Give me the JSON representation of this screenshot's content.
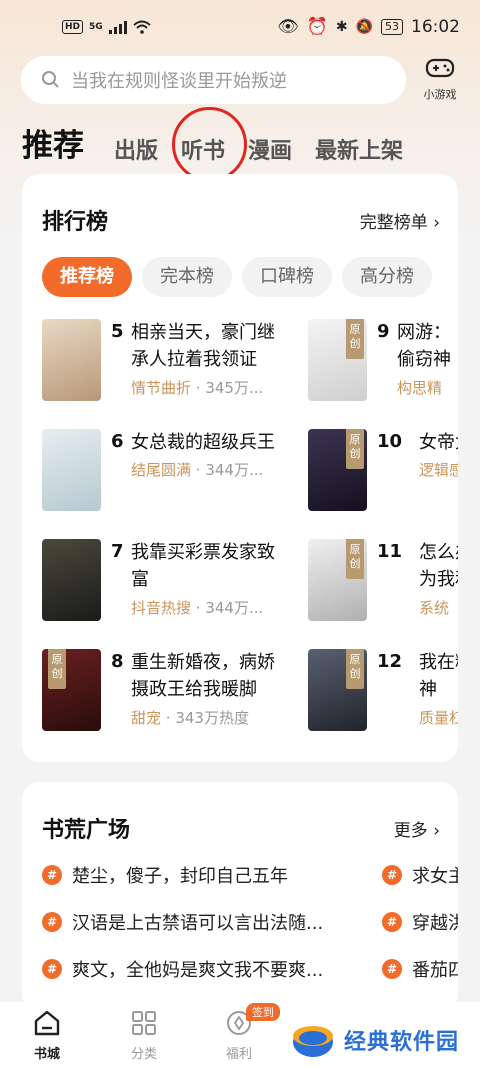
{
  "status_bar": {
    "time": "16:02",
    "battery": "53",
    "network": "5G"
  },
  "search": {
    "placeholder": "当我在规则怪谈里开始叛逆"
  },
  "game_button": {
    "label": "小游戏"
  },
  "tabs": [
    {
      "label": "推荐",
      "active": true
    },
    {
      "label": "出版"
    },
    {
      "label": "听书"
    },
    {
      "label": "漫画"
    },
    {
      "label": "最新上架"
    }
  ],
  "ranking": {
    "title": "排行榜",
    "more": "完整榜单 ›",
    "pills": [
      "推荐榜",
      "完本榜",
      "口碑榜",
      "高分榜"
    ],
    "items_left": [
      {
        "rank": "5",
        "title": "相亲当天，豪门继承人拉着我领证",
        "tag": "情节曲折",
        "heat": "· 345万...",
        "cover_color": "#d9c7b0",
        "badge": ""
      },
      {
        "rank": "6",
        "title": "女总裁的超级兵王",
        "tag": "结尾圆满",
        "heat": "· 344万...",
        "cover_color": "#cfe0e8",
        "badge": ""
      },
      {
        "rank": "7",
        "title": "我靠买彩票发家致富",
        "tag": "抖音热搜",
        "heat": "· 344万...",
        "cover_color": "#2a2a2a",
        "badge": ""
      },
      {
        "rank": "8",
        "title": "重生新婚夜，病娇摄政王给我暖脚",
        "tag": "甜宠",
        "heat": "· 343万热度",
        "cover_color": "#3a1a1a",
        "badge": "原创"
      }
    ],
    "items_right": [
      {
        "rank": "9",
        "title": "网游：偷窃神",
        "tag": "构思精",
        "cover_color": "#eaeaea",
        "badge": "原创"
      },
      {
        "rank": "10",
        "title": "女帝太",
        "tag": "逻辑感",
        "cover_color": "#2c2540",
        "badge": "原创"
      },
      {
        "rank": "11",
        "title": "怎么办为我和",
        "tag": "系统",
        "cover_color": "#e8e8e8",
        "badge": "原创"
      },
      {
        "rank": "12",
        "title": "我在精神",
        "tag": "质量杠",
        "cover_color": "#3a3e4a",
        "badge": "原创"
      }
    ]
  },
  "plaza": {
    "title": "书荒广场",
    "more": "更多 ›",
    "left": [
      "楚尘，傻子，封印自己五年",
      "汉语是上古禁语可以言出法随...",
      "爽文，全他妈是爽文我不要爽..."
    ],
    "right": [
      "求女主",
      "穿越洪",
      "番茄四"
    ]
  },
  "bottom_nav": [
    {
      "label": "书城",
      "active": true
    },
    {
      "label": "分类"
    },
    {
      "label": "福利"
    }
  ],
  "sign_badge": "签到",
  "watermark": "经典软件园"
}
